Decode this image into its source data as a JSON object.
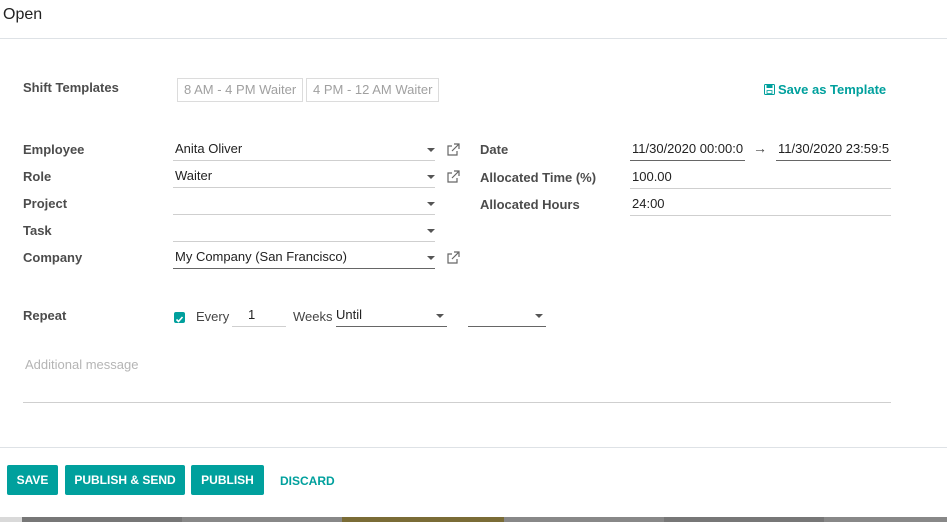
{
  "dialog": {
    "title": "Open"
  },
  "shift_templates": {
    "label": "Shift Templates",
    "templates": [
      "8 AM - 4 PM Waiter",
      "4 PM - 12 AM Waiter"
    ],
    "save_as_template": "Save as Template"
  },
  "left_fields": {
    "employee": {
      "label": "Employee",
      "value": "Anita Oliver"
    },
    "role": {
      "label": "Role",
      "value": "Waiter"
    },
    "project": {
      "label": "Project",
      "value": ""
    },
    "task": {
      "label": "Task",
      "value": ""
    },
    "company": {
      "label": "Company",
      "value": "My Company (San Francisco)"
    }
  },
  "right_fields": {
    "date": {
      "label": "Date",
      "start": "11/30/2020 00:00:0",
      "end": "11/30/2020 23:59:5",
      "arrow": "→"
    },
    "allocated_time": {
      "label": "Allocated Time (%)",
      "value": "100.00"
    },
    "allocated_hours": {
      "label": "Allocated Hours",
      "value": "24:00"
    }
  },
  "repeat": {
    "label": "Repeat",
    "checked": true,
    "every_label": "Every",
    "interval": "1",
    "unit_label": "Weeks",
    "until_value": "Until",
    "until_date": ""
  },
  "message": {
    "placeholder": "Additional message"
  },
  "footer": {
    "save": "SAVE",
    "publish_send": "PUBLISH & SEND",
    "publish": "PUBLISH",
    "discard": "DISCARD"
  },
  "colors": {
    "accent": "#00a09d"
  }
}
